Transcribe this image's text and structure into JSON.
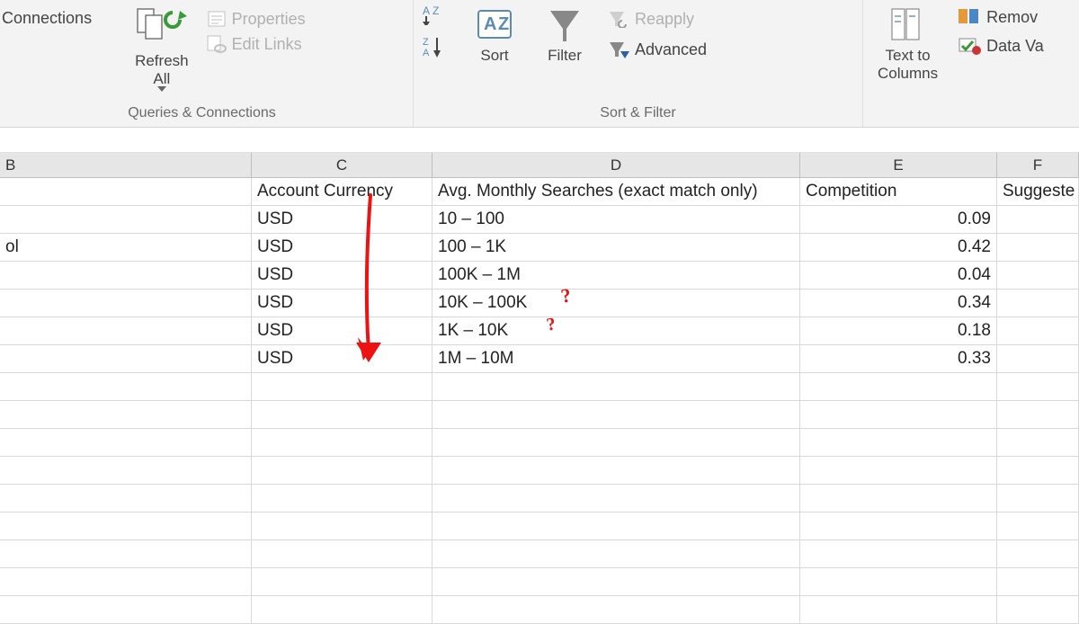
{
  "ribbon": {
    "connections_label": "Connections",
    "refresh_label": "Refresh\nAll",
    "properties_label": "Properties",
    "edit_links_label": "Edit Links",
    "queries_group": "Queries & Connections",
    "sort_label": "Sort",
    "filter_label": "Filter",
    "reapply_label": "Reapply",
    "advanced_label": "Advanced",
    "sortfilter_group": "Sort & Filter",
    "text_to_cols": "Text to\nColumns",
    "remove_label": "Remov",
    "data_val_label": "Data Va"
  },
  "col_headers": {
    "b": "B",
    "c": "C",
    "d": "D",
    "e": "E",
    "f": "F"
  },
  "headers": {
    "c": "Account Currency",
    "d": "Avg. Monthly Searches (exact match only)",
    "e": "Competition",
    "f": "Suggeste"
  },
  "rows": [
    {
      "b": "",
      "c": "USD",
      "d": "10 – 100",
      "e": "0.09"
    },
    {
      "b": "ol",
      "c": "USD",
      "d": "100 – 1K",
      "e": "0.42"
    },
    {
      "b": "",
      "c": "USD",
      "d": "100K – 1M",
      "e": "0.04"
    },
    {
      "b": "",
      "c": "USD",
      "d": "10K – 100K",
      "e": "0.34"
    },
    {
      "b": "",
      "c": "USD",
      "d": "1K – 10K",
      "e": "0.18"
    },
    {
      "b": "",
      "c": "USD",
      "d": "1M – 10M",
      "e": "0.33"
    }
  ],
  "annotations": {
    "q1": "?",
    "q2": "?"
  }
}
